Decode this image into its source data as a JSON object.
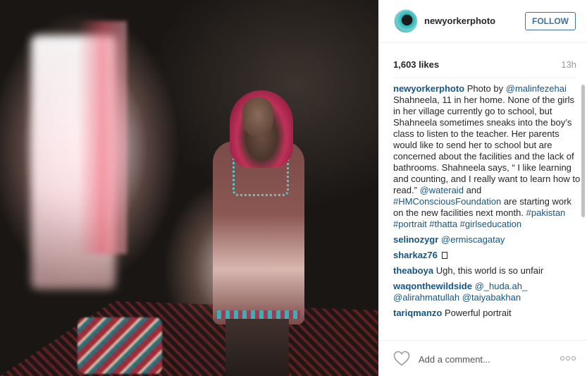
{
  "post": {
    "username": "newyorkerphoto",
    "follow_label": "FOLLOW",
    "likes": "1,603 likes",
    "age": "13h"
  },
  "caption": {
    "username": "newyorkerphoto",
    "text_1": "Photo by",
    "mention_1": "@malinfezehai",
    "text_2": "Shahneela, 11 in her home. None of the girls in her village currently go to school, but Shahneela sometimes sneaks into the boy’s class to listen to the teacher. Her parents would like to send her to school but are concerned about the facilities and the lack of bathrooms. Shahneela says, “ I like learning and counting, and I really want to learn how to read.”",
    "mention_2": "@wateraid",
    "text_3": "and",
    "hashtag_1": "#HMConsciousFoundation",
    "text_4": "are starting work on the new facilities next month.",
    "hashtags": "#pakistan #portrait #thatta #girlseducation"
  },
  "comments": [
    {
      "user": "selinozygr",
      "mentions": "@ermiscagatay",
      "text": ""
    },
    {
      "user": "sharkaz76",
      "mentions": "",
      "text": ""
    },
    {
      "user": "theaboya",
      "mentions": "",
      "text": "Ugh, this world is so unfair"
    },
    {
      "user": "waqonthewildside",
      "mentions": "@_huda.ah_ @alirahmatullah @taiyabakhan",
      "text": ""
    },
    {
      "user": "tariqmanzo",
      "mentions": "",
      "text": "Powerful portrait"
    }
  ],
  "footer": {
    "comment_placeholder": "Add a comment...",
    "heart_icon": "heart-outline-icon",
    "more_icon": "more-options-icon"
  },
  "colors": {
    "link": "#125688",
    "follow": "#3f729b",
    "muted": "#999999"
  }
}
